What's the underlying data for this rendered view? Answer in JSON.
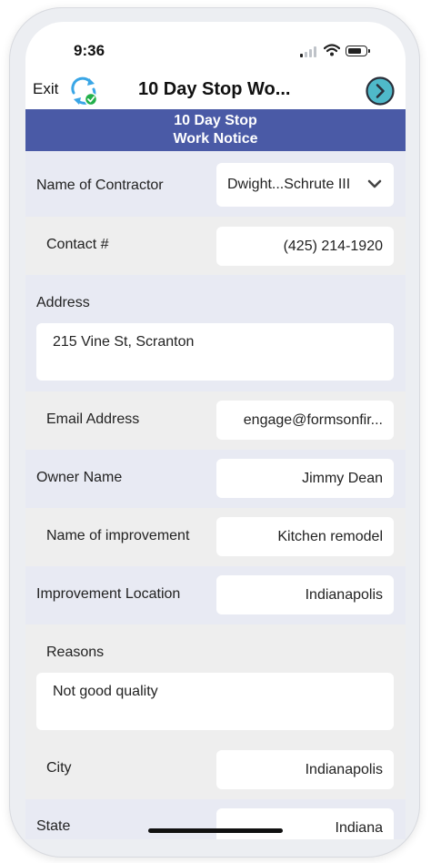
{
  "status_bar": {
    "time": "9:36"
  },
  "nav": {
    "exit_label": "Exit",
    "title": "10 Day Stop Wo..."
  },
  "form": {
    "header_line1": "10 Day Stop",
    "header_line2": "Work Notice",
    "fields": {
      "contractor": {
        "label": "Name of Contractor",
        "value": "Dwight...Schrute III"
      },
      "contact": {
        "label": "Contact #",
        "value": "(425) 214-1920"
      },
      "address": {
        "label": "Address",
        "value": "215 Vine St, Scranton"
      },
      "email": {
        "label": "Email Address",
        "value": "engage@formsonfir..."
      },
      "owner": {
        "label": "Owner Name",
        "value": "Jimmy Dean"
      },
      "improvement": {
        "label": "Name of improvement",
        "value": "Kitchen remodel"
      },
      "location": {
        "label": "Improvement Location",
        "value": "Indianapolis"
      },
      "reasons": {
        "label": "Reasons",
        "value": "Not good quality"
      },
      "city": {
        "label": "City",
        "value": "Indianapolis"
      },
      "state": {
        "label": "State",
        "value": "Indiana"
      }
    }
  },
  "colors": {
    "header_bg": "#4a5aa6",
    "form_bg": "#e8eaf3",
    "sync_blue": "#3aa6e6",
    "check_green": "#23b04a"
  }
}
